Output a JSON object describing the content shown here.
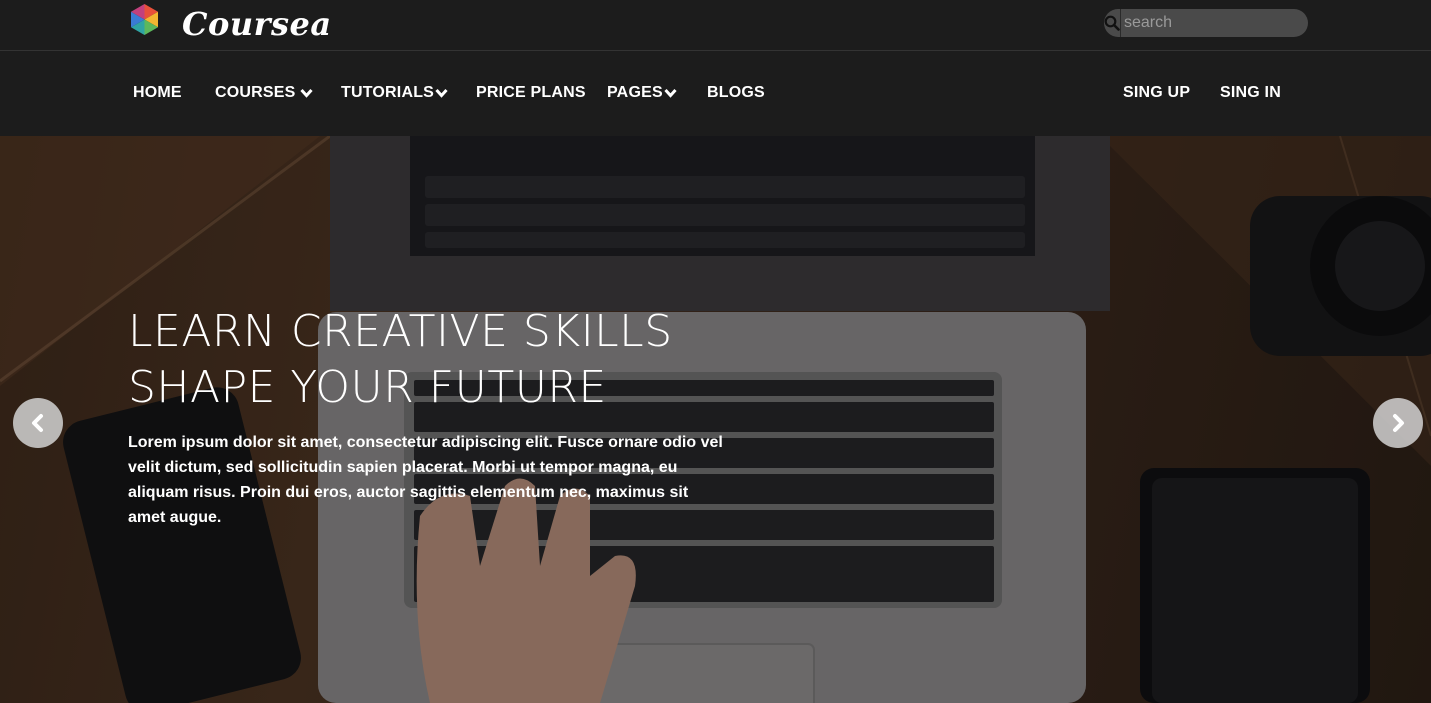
{
  "brand": {
    "name": "Coursea"
  },
  "search": {
    "placeholder": "search"
  },
  "nav": {
    "items": [
      {
        "label": "HOME",
        "dropdown": false
      },
      {
        "label": "COURSES",
        "dropdown": true
      },
      {
        "label": "TUTORIALS",
        "dropdown": true
      },
      {
        "label": "PRICE PLANS",
        "dropdown": false
      },
      {
        "label": "PAGES",
        "dropdown": true
      },
      {
        "label": "BLOGS",
        "dropdown": false
      }
    ],
    "auth": [
      {
        "label": "SING UP"
      },
      {
        "label": "SING IN"
      }
    ]
  },
  "hero": {
    "title_line1": "LEARN CREATIVE SKILLS",
    "title_line2": "SHAPE YOUR FUTURE",
    "text": "Lorem ipsum dolor sit amet, consectetur adipiscing elit. Fusce ornare odio vel velit dictum, sed sollicitudin sapien placerat. Morbi ut tempor magna, eu aliquam risus. Proin dui eros, auctor sagittis elementum nec, maximus sit amet augue."
  },
  "icons": {
    "logo": "coursea-logo-icon",
    "search": "search-icon",
    "chevron": "chevron-down-icon",
    "prev": "chevron-left-icon",
    "next": "chevron-right-icon"
  },
  "colors": {
    "nav_bg": "#1c1c1c",
    "search_bg": "#4a4a4a",
    "arrow_bg": "#d2d2d2"
  }
}
